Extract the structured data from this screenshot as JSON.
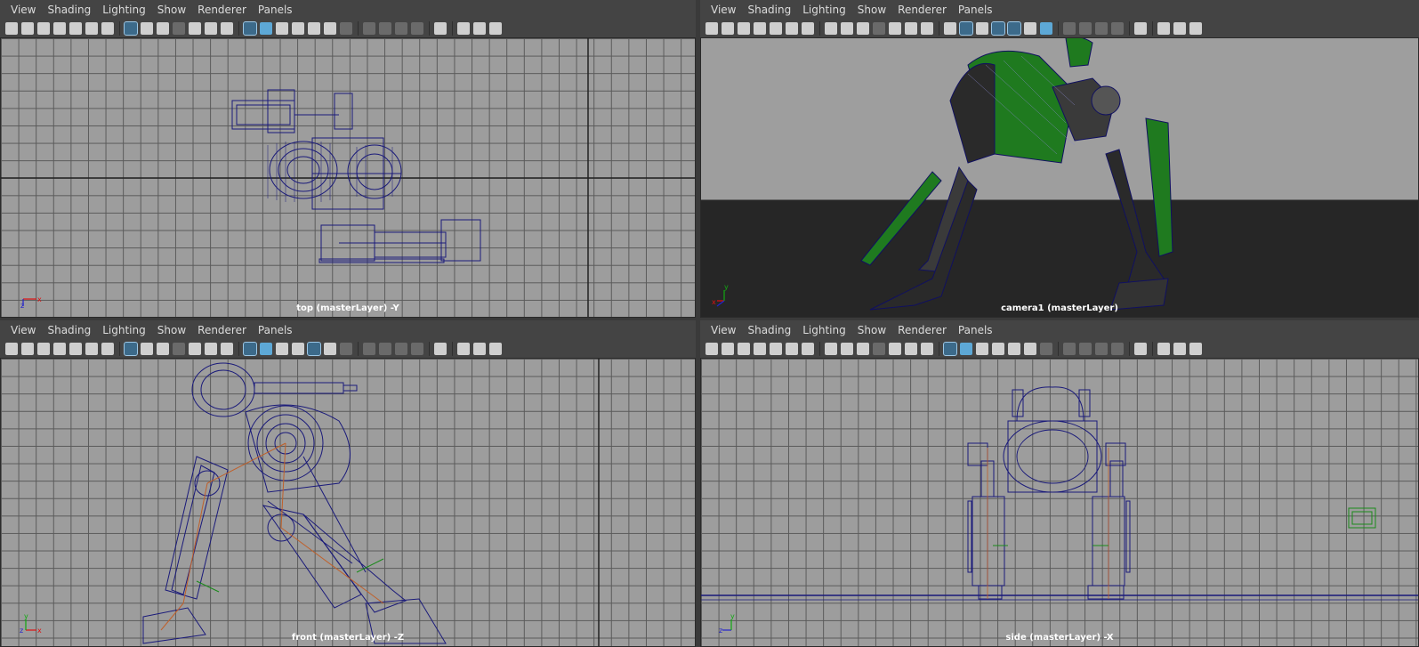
{
  "menus": [
    "View",
    "Shading",
    "Lighting",
    "Show",
    "Renderer",
    "Panels"
  ],
  "panels": {
    "top": {
      "camera_label": "top (masterLayer) -Y"
    },
    "persp": {
      "camera_label": "camera1 (masterLayer)"
    },
    "front": {
      "camera_label": "front (masterLayer) -Z"
    },
    "side": {
      "camera_label": "side (masterLayer) -X"
    }
  },
  "axis_labels": {
    "x": "x",
    "y": "y",
    "z": "z"
  },
  "colors": {
    "wire": "#1a1a7a",
    "grid": "#5a5a5a",
    "viewport_bg": "#9d9d9d",
    "floor": "#262626",
    "shade_green": "#1f7a1f",
    "joint": "#c0602a"
  },
  "icons": [
    "camera-icon",
    "camera-lock-icon",
    "camera-attr-icon",
    "bookmark-icon",
    "pencil-icon",
    "pan-icon",
    "grease-pencil-icon",
    "grid-icon",
    "film-gate-icon",
    "resolution-gate-icon",
    "gate-mask-icon",
    "field-chart-icon",
    "safe-action-icon",
    "safe-title-icon",
    "wireframe-icon",
    "smooth-shade-icon",
    "default-material-icon",
    "wireframe-on-shaded-icon",
    "xray-icon",
    "use-lights-icon",
    "shadows-icon",
    "screen-ao-icon",
    "motion-blur-icon",
    "aa-icon",
    "dof-icon",
    "isolate-icon",
    "xray-joints-icon",
    "xray-active-icon",
    "camera-attributes-icon"
  ]
}
